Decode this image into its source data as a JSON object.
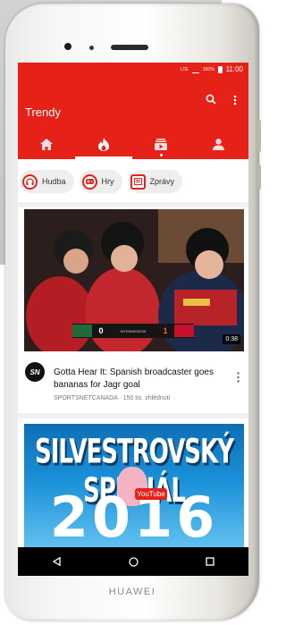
{
  "device": {
    "brand": "HUAWEI"
  },
  "status_bar": {
    "network": "LTE",
    "battery": "100%",
    "time": "11:00"
  },
  "app_bar": {
    "title": "Trendy"
  },
  "tabs": [
    {
      "icon": "home-icon"
    },
    {
      "icon": "flame-icon",
      "selected": true
    },
    {
      "icon": "subscriptions-icon"
    },
    {
      "icon": "account-icon"
    }
  ],
  "chips": [
    {
      "label": "Hudba",
      "icon": "headphones-icon"
    },
    {
      "label": "Hry",
      "icon": "gamepad-icon"
    },
    {
      "label": "Zprávy",
      "icon": "news-icon"
    }
  ],
  "videos": [
    {
      "title": "Gotta Hear It: Spanish broadcaster goes bananas for Jagr goal",
      "channel_logo": "SN",
      "channel": "SPORTSNETCANADA",
      "views": "150 tis. zhlédnutí",
      "duration": "0:38",
      "score": {
        "left": "0",
        "right": "1",
        "period": "INTERMISSION"
      }
    },
    {
      "thumbnail_title": "SILVESTROVSKÝ SPECIÁL",
      "thumbnail_year": "2016",
      "thumbnail_badge": "YouTube"
    }
  ],
  "colors": {
    "accent": "#e62117",
    "chip_bg": "#eeeeee",
    "nav_bg": "#000000"
  }
}
